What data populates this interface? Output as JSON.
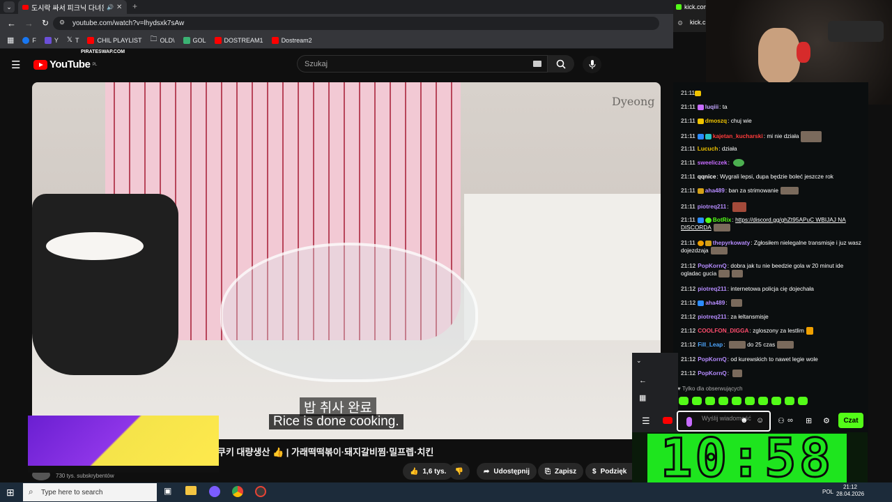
{
  "browser": {
    "tab_title": "도시락 싸서 피크닉 다녀온",
    "url": "youtube.com/watch?v=lhydsxk7sAw",
    "bookmarks": [
      {
        "label": "F",
        "color": "#1877f2"
      },
      {
        "label": "Y",
        "color": "#6b4fd8"
      },
      {
        "label": "T",
        "color": "#ffffff"
      },
      {
        "label": "CHIL PLAYLIST",
        "color": "#ff0000"
      },
      {
        "label": "OLD\\",
        "color": "#cccccc"
      },
      {
        "label": "GOL",
        "color": "#3bb273"
      },
      {
        "label": "DOSTREAM1",
        "color": "#ff0000"
      },
      {
        "label": "Dostream2",
        "color": "#ff0000"
      }
    ]
  },
  "youtube": {
    "logo": "YouTube",
    "region": "PL",
    "search_placeholder": "Szukaj",
    "subtitle_ko": "밥 취사 완료",
    "subtitle_en": "Rice is done cooking.",
    "watermark": "Dyeong",
    "video_title": "쿠키 대량생산 👍 | 가래떡떡볶이·돼지갈비찜·밀프렙·치킨",
    "channel_subs": "730 tys. subskrybentów",
    "likes": "1,6 tys.",
    "share": "Udostępnij",
    "save": "Zapisz",
    "thanks": "Podzięk"
  },
  "ad": {
    "label": "PIRATESWAP.COM"
  },
  "kick": {
    "tab_title": "kick.com",
    "tab2": "kick.c",
    "followers_only": "Tylko dla obserwujących",
    "input_placeholder": "Wyślij wiadomość",
    "chat_button": "Czat",
    "messages": [
      {
        "time": "21:11",
        "user": "luqiii",
        "color": "#c5a7ff",
        "text": "ta"
      },
      {
        "time": "21:11",
        "user": "dmoszq",
        "color": "#f0c400",
        "text": "chuj wie"
      },
      {
        "time": "21:11",
        "user": "kajetan_kucharski",
        "color": "#ff3b3b",
        "text": "mi nie działa"
      },
      {
        "time": "21:11",
        "user": "Lucuch",
        "color": "#f0c400",
        "text": "działa"
      },
      {
        "time": "21:11",
        "user": "sweeliczek",
        "color": "#c76cff",
        "text": ""
      },
      {
        "time": "21:11",
        "user": "qqnice",
        "color": "#ffffff",
        "text": "Wygrali lepsi, dupa będzie boleć jeszcze rok"
      },
      {
        "time": "21:11",
        "user": "aha489",
        "color": "#b68cff",
        "text": "ban za strimowanie"
      },
      {
        "time": "21:11",
        "user": "piotreq211",
        "color": "#b68cff",
        "text": ""
      },
      {
        "time": "21:11",
        "user": "BotRix",
        "color": "#53fc18",
        "text": "https://discord.gg/ghZt95APuC WBIJAJ NA DISCORDA"
      },
      {
        "time": "21:11",
        "user": "thepyrkowaty",
        "color": "#b68cff",
        "text": "Zgłosiłem nielegalne transmisje i juz wasz dojezdzaja"
      },
      {
        "time": "21:12",
        "user": "PopKornQ",
        "color": "#b68cff",
        "text": "dobra jak tu nie beedzie gola w 20 minut ide ogladac gucia"
      },
      {
        "time": "21:12",
        "user": "piotreq211",
        "color": "#b68cff",
        "text": "internetowa policja cię dojechała"
      },
      {
        "time": "21:12",
        "user": "aha489",
        "color": "#b68cff",
        "text": ""
      },
      {
        "time": "21:12",
        "user": "piotreq211",
        "color": "#b68cff",
        "text": "za łeltansmisje"
      },
      {
        "time": "21:12",
        "user": "COOLFON_DIGGA",
        "color": "#ff4d6d",
        "text": "zgloszony za lestlim"
      },
      {
        "time": "21:12",
        "user": "Fill_Leap",
        "color": "#4da6ff",
        "text": "do 25 czas"
      },
      {
        "time": "21:12",
        "user": "PopKornQ",
        "color": "#b68cff",
        "text": "od kurewskich to nawet legie wole"
      },
      {
        "time": "21:12",
        "user": "PopKornQ",
        "color": "#b68cff",
        "text": ""
      }
    ]
  },
  "clock": "10:58",
  "taskbar": {
    "search": "Type here to search",
    "lang": "POL",
    "time": "21:12",
    "date": "28.04.2026"
  }
}
